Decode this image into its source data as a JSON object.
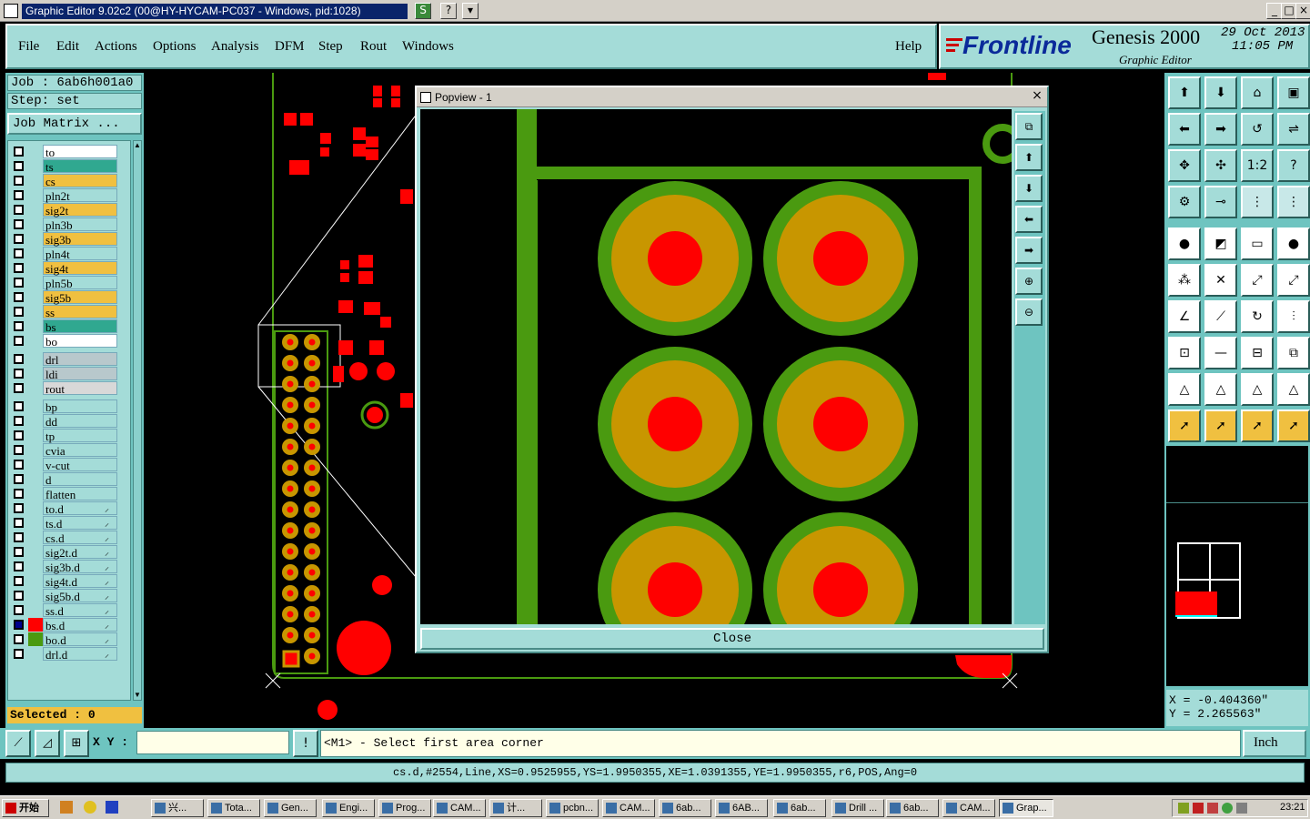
{
  "window": {
    "title": "Graphic Editor 9.02c2 (00@HY-HYCAM-PC037 - Windows, pid:1028)"
  },
  "menu": {
    "items": [
      "File",
      "Edit",
      "Actions",
      "Options",
      "Analysis",
      "DFM",
      "Step",
      "Rout",
      "Windows"
    ],
    "help": "Help"
  },
  "brand": {
    "logo": "Frontline",
    "product": "Genesis 2000",
    "subtitle": "Graphic Editor",
    "date": "29 Oct 2013",
    "time": "11:05 PM"
  },
  "job": {
    "job_label": "Job  :  6ab6h001a0",
    "step_label": "Step:  set",
    "matrix_button": "Job Matrix ..."
  },
  "layers": [
    {
      "name": "to",
      "color": "#ffffff"
    },
    {
      "name": "ts",
      "color": "#30a890"
    },
    {
      "name": "cs",
      "color": "#f0c040"
    },
    {
      "name": "pln2t",
      "color": "#a4dcd8"
    },
    {
      "name": "sig2t",
      "color": "#f0c040"
    },
    {
      "name": "pln3b",
      "color": "#a4dcd8"
    },
    {
      "name": "sig3b",
      "color": "#f0c040"
    },
    {
      "name": "pln4t",
      "color": "#a4dcd8"
    },
    {
      "name": "sig4t",
      "color": "#f0c040"
    },
    {
      "name": "pln5b",
      "color": "#a4dcd8"
    },
    {
      "name": "sig5b",
      "color": "#f0c040"
    },
    {
      "name": "ss",
      "color": "#f0c040"
    },
    {
      "name": "bs",
      "color": "#30a890"
    },
    {
      "name": "bo",
      "color": "#ffffff"
    },
    {
      "name": "drl",
      "color": "#b8c8cc"
    },
    {
      "name": "ldi",
      "color": "#b8c8cc"
    },
    {
      "name": "rout",
      "color": "#d8d8d8"
    },
    {
      "name": "bp",
      "color": "#a4dcd8"
    },
    {
      "name": "dd",
      "color": "#a4dcd8"
    },
    {
      "name": "tp",
      "color": "#a4dcd8"
    },
    {
      "name": "cvia",
      "color": "#a4dcd8"
    },
    {
      "name": "v-cut",
      "color": "#a4dcd8"
    },
    {
      "name": "d",
      "color": "#a4dcd8"
    },
    {
      "name": "flatten",
      "color": "#a4dcd8"
    },
    {
      "name": "to.d",
      "color": "#a4dcd8"
    },
    {
      "name": "ts.d",
      "color": "#a4dcd8"
    },
    {
      "name": "cs.d",
      "color": "#a4dcd8"
    },
    {
      "name": "sig2t.d",
      "color": "#a4dcd8"
    },
    {
      "name": "sig3b.d",
      "color": "#a4dcd8"
    },
    {
      "name": "sig4t.d",
      "color": "#a4dcd8"
    },
    {
      "name": "sig5b.d",
      "color": "#a4dcd8"
    },
    {
      "name": "ss.d",
      "color": "#a4dcd8"
    },
    {
      "name": "bs.d",
      "color": "#a4dcd8"
    },
    {
      "name": "bo.d",
      "color": "#a4dcd8"
    },
    {
      "name": "drl.d",
      "color": "#a4dcd8"
    }
  ],
  "selected": "Selected : 0",
  "popview": {
    "title": "Popview - 1",
    "close_label": "Close"
  },
  "coords": {
    "x": "X = -0.404360\"",
    "y": "Y = 2.265563\""
  },
  "bottom": {
    "xy_label": "X Y :",
    "xy_value": "",
    "prompt": "<M1> - Select first area corner",
    "units": "Inch"
  },
  "status": "cs.d,#2554,Line,XS=0.9525955,YS=1.9950355,XE=1.0391355,YE=1.9950355,r6,POS,Ang=0",
  "taskbar": {
    "start": "开始",
    "tasks": [
      "兴...",
      "Tota...",
      "Gen...",
      "Engi...",
      "Prog...",
      "CAM...",
      "计...",
      "pcbn...",
      "CAM...",
      "6ab...",
      "6AB...",
      "6ab...",
      "Drill ...",
      "6ab...",
      "CAM...",
      "Grap..."
    ],
    "clock": "23:21"
  },
  "colors": {
    "teal": "#a4dcd8",
    "copper": "#c89600",
    "green": "#4a9a10",
    "red": "#ff0000"
  }
}
